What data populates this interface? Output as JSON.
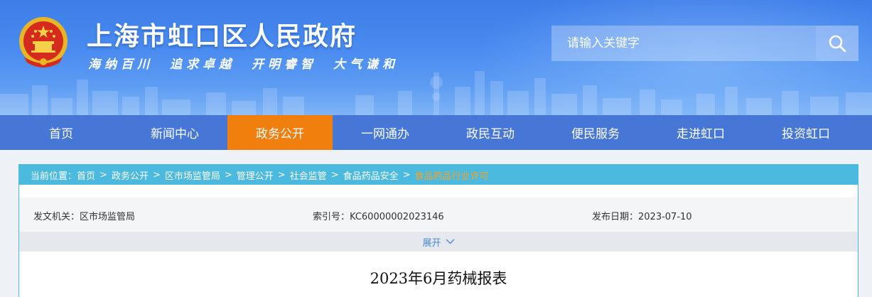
{
  "header": {
    "title": "上海市虹口区人民政府",
    "motto": "海纳百川　追求卓越　开明睿智　大气谦和",
    "search_placeholder": "请输入关键字"
  },
  "nav": {
    "items": [
      {
        "label": "首页"
      },
      {
        "label": "新闻中心"
      },
      {
        "label": "政务公开",
        "active": true
      },
      {
        "label": "一网通办"
      },
      {
        "label": "政民互动"
      },
      {
        "label": "便民服务"
      },
      {
        "label": "走进虹口"
      },
      {
        "label": "投资虹口"
      }
    ]
  },
  "breadcrumb": {
    "prefix": "当前位置：",
    "items": [
      "首页",
      "政务公开",
      "区市场监管局",
      "管理公开",
      "社会监管",
      "食品药品安全",
      "食品药品行业许可"
    ],
    "separator": ">"
  },
  "meta": {
    "issuer_label": "发文机关：",
    "issuer": "区市场监管局",
    "index_label": "索引号：",
    "index": "KC60000002023146",
    "date_label": "发布日期：",
    "date": "2023-07-10"
  },
  "expand_label": "展开",
  "document": {
    "title": "2023年6月药械报表"
  },
  "colors": {
    "header_blue": "#3d7de8",
    "nav_blue": "#4777d6",
    "nav_active": "#f17f0e",
    "breadcrumb_bg": "#4cbadf",
    "breadcrumb_current": "#f6a12a"
  }
}
